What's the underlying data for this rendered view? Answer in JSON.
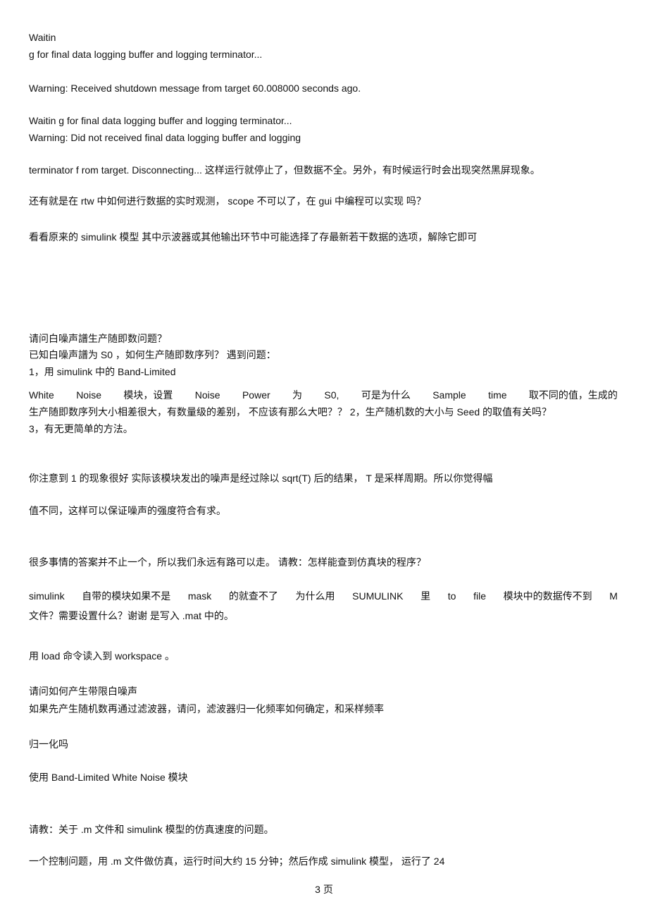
{
  "page": {
    "lines": {
      "l1": "Waitin",
      "l2": "g for final data logging buffer and logging terminator...",
      "l3": "Warning: Received shutdown message from target 60.008000 seconds ago.",
      "l4": "Waitin g for final data logging buffer and logging terminator...",
      "l5": "Warning: Did not received final data logging buffer and logging",
      "l6": "terminator f rom target. Disconnecting... 这样运行就停止了，但数据不全。另外，有时候运行时会出现突然黑屏现象。",
      "l7": "还有就是在  rtw 中如何进行数据的实时观测，  scope 不可以了，在  gui 中编程可以实现  吗？",
      "l8": "看看原来的  simulink 模型  其中示波器或其他输出环节中可能选择了存最新若干数据的选项，解除它即可",
      "l9": "请问白噪声譜生产随即数问题？",
      "l10": "已知白噪声譜为  S0 ，如何生产随即数序列？  遇到问题：",
      "l11": "1，用  simulink 中的  Band-Limited",
      "l12_parts": [
        "White",
        "Noise",
        "模块，设置",
        "Noise",
        "Power",
        "为",
        "S0,",
        "可是为什么",
        "Sample",
        "time",
        "取不同的值，生成的"
      ],
      "l13": "生产随即数序列大小相差很大，有数量级的差别，      不应该有那么大吧？？     2，生产随机数的大小与      Seed      的取值有关吗？",
      "l14": "3，有无更简单的方法。",
      "l15": "你注意到  1 的现象很好  实际该模块发出的噪声是经过除以  sqrt(T) 后的结果，  T 是采样周期。所以你觉得幅",
      "l16": "值不同，这样可以保证噪声的强度符合有求。",
      "l17": "很多事情的答案并不止一个，所以我们永远有路可以走。  请教：怎样能查到仿真块的程序？",
      "l18_parts": [
        "simulink",
        "自带的模块如果不是",
        "mask",
        "的就查不了",
        "为什么用",
        "SUMULINK",
        "里",
        "to",
        "file",
        "模块中的数据传不到",
        "M"
      ],
      "l19": "文件？需要设置什么？谢谢  是写入  .mat 中的。",
      "l20": "用  load 命令读入到  workspace  。",
      "l21": "请问如何产生带限白噪声",
      "l22": "如果先产生随机数再通过滤波器，请问，滤波器归一化频率如何确定，和采样频率",
      "l23": "归一化吗",
      "l24": "使用  Band-Limited White Noise 模块",
      "l25": "请教：关于  .m 文件和  simulink 模型的仿真速度的问题。",
      "l26": "一个控制问题，用  .m 文件做仿真，运行时间大约  15 分钟；然后作成  simulink 模型，  运行了  24"
    },
    "footer": "3 页"
  }
}
